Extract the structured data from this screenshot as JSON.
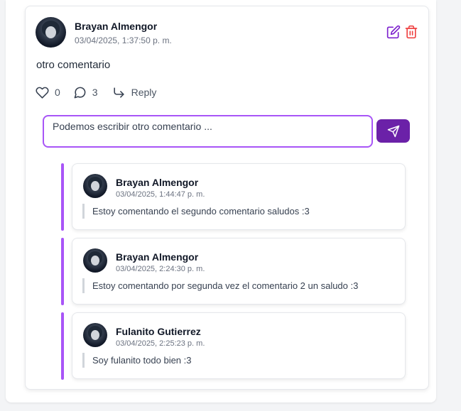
{
  "comment": {
    "author": "Brayan Almengor",
    "date": "03/04/2025, 1:37:50 p. m.",
    "content": "otro comentario",
    "likes": "0",
    "replies_count": "3",
    "reply_label": "Reply",
    "edit_icon": "edit-icon",
    "delete_icon": "trash-icon"
  },
  "reply_form": {
    "value": "Podemos escribir otro comentario ...",
    "send_icon": "send-icon"
  },
  "replies": [
    {
      "author": "Brayan Almengor",
      "date": "03/04/2025, 1:44:47 p. m.",
      "text": "Estoy comentando el segundo comentario saludos :3"
    },
    {
      "author": "Brayan Almengor",
      "date": "03/04/2025, 2:24:30 p. m.",
      "text": "Estoy comentando por segunda vez el comentario 2 un saludo :3"
    },
    {
      "author": "Fulanito Gutierrez",
      "date": "03/04/2025, 2:25:23 p. m.",
      "text": "Soy fulanito todo bien :3"
    }
  ],
  "colors": {
    "accent": "#a855f7",
    "send_button": "#6b21a8",
    "edit_icon": "#7e22ce",
    "delete_icon": "#ef4444"
  }
}
